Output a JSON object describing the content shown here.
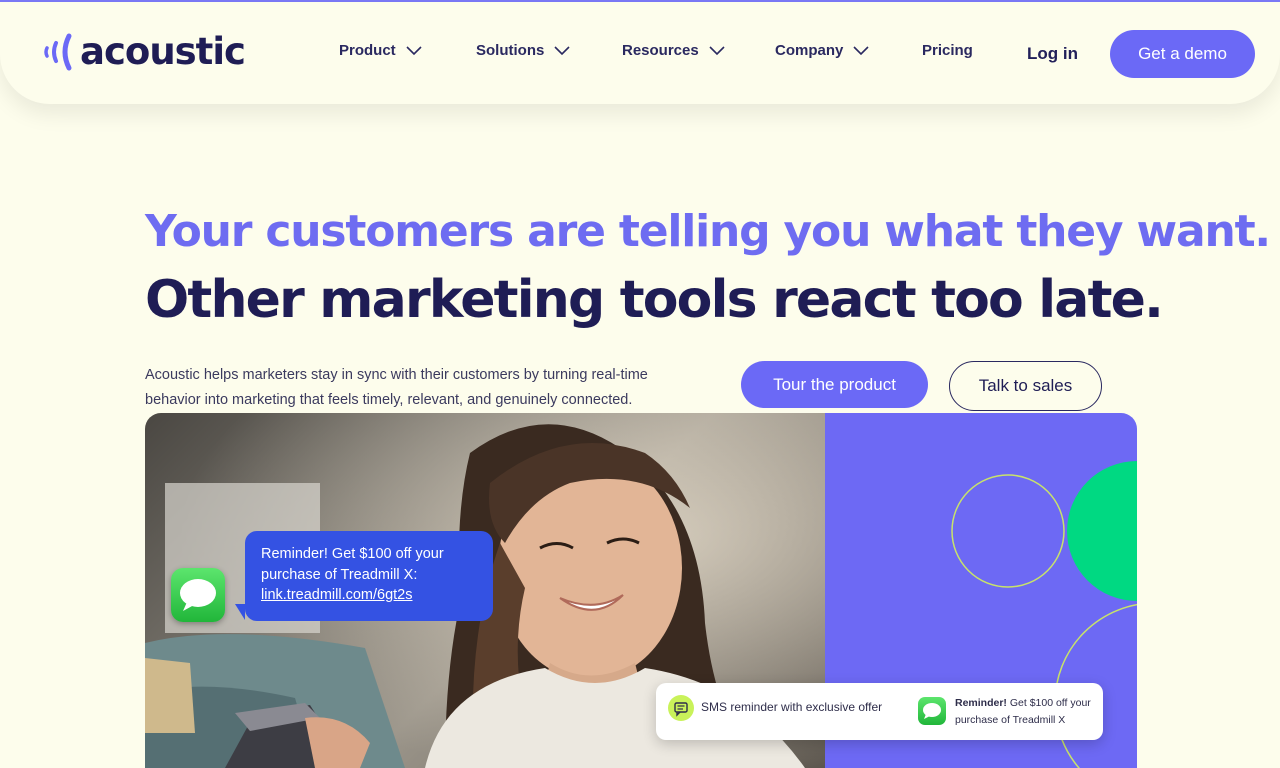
{
  "colors": {
    "background": "#fdfdec",
    "brand_purple": "#6b69f6",
    "navy": "#1f1d55",
    "bubble_blue": "#3452e3",
    "accent_green": "#00d982"
  },
  "logo": {
    "text": "acoustic",
    "icon": "sound-waves-icon"
  },
  "nav": {
    "items": [
      {
        "label": "Product",
        "has_dropdown": true
      },
      {
        "label": "Solutions",
        "has_dropdown": true
      },
      {
        "label": "Resources",
        "has_dropdown": true
      },
      {
        "label": "Company",
        "has_dropdown": true
      },
      {
        "label": "Pricing",
        "has_dropdown": false
      }
    ],
    "login": "Log in",
    "cta": "Get a demo"
  },
  "hero": {
    "headline_1": "Your customers are telling you what they want.",
    "headline_2": "Other marketing tools react too late.",
    "description": "Acoustic helps marketers stay in sync with their customers by turning real-time behavior into marketing that feels timely, relevant, and genuinely connected.",
    "primary_button": "Tour the product",
    "secondary_button": "Talk to sales"
  },
  "sms_bubble": {
    "line_1": "Reminder! Get $100 off your",
    "line_2": "purchase of Treadmill X:",
    "link": "link.treadmill.com/6gt2s"
  },
  "notification": {
    "left_text": "SMS reminder with exclusive offer",
    "right_bold": "Reminder!",
    "right_text": " Get $100 off your purchase of Treadmill X"
  }
}
